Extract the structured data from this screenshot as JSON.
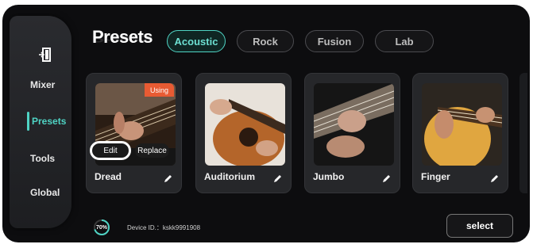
{
  "header": {
    "title": "Presets"
  },
  "tabs": [
    {
      "label": "Acoustic",
      "active": true
    },
    {
      "label": "Rock",
      "active": false
    },
    {
      "label": "Fusion",
      "active": false
    },
    {
      "label": "Lab",
      "active": false
    }
  ],
  "sidebar": {
    "exit_icon": "exit-door-icon",
    "items": [
      {
        "label": "Mixer"
      },
      {
        "label": "Presets",
        "active": true
      },
      {
        "label": "Tools"
      },
      {
        "label": "Global"
      }
    ]
  },
  "presets": [
    {
      "name": "Dread",
      "badge": "Using",
      "edit_label": "Edit",
      "replace_label": "Replace"
    },
    {
      "name": "Auditorium"
    },
    {
      "name": "Jumbo"
    },
    {
      "name": "Finger"
    }
  ],
  "footer": {
    "progress": "70%",
    "progress_value": 0.7,
    "device_id": "Device ID.：kskk9991908",
    "select_label": "select"
  },
  "colors": {
    "accent": "#4fd3c4",
    "badge": "#e85b33",
    "background": "#0d0d0f"
  }
}
